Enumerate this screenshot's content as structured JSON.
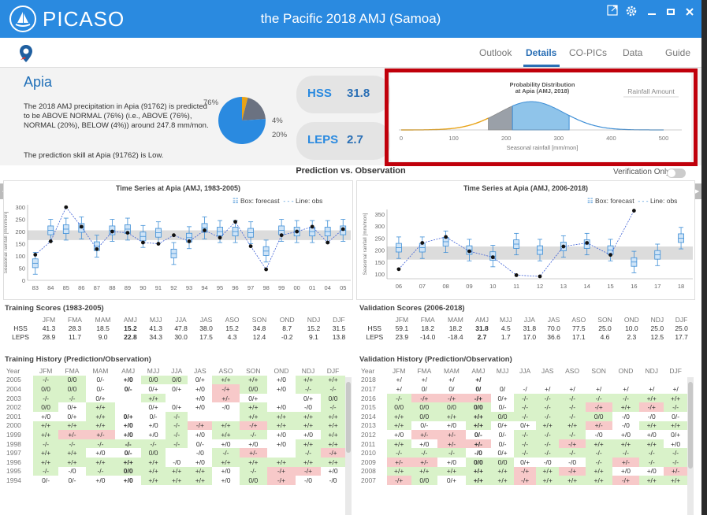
{
  "window": {
    "logo": "PICASO",
    "title": "the Pacific 2018 AMJ (Samoa)"
  },
  "nav": {
    "tabs": [
      "Outlook",
      "Details",
      "CO-PICs",
      "Data",
      "Guide"
    ],
    "active": "Details"
  },
  "summary": {
    "city": "Apia",
    "description": "The 2018 AMJ precipitation in Apia (91762) is predicted to be ABOVE NORMAL (76%) (i.e., ABOVE (76%), NORMAL (20%), BELOW (4%)) around 247.8 mm/mon.",
    "skill_text": "The prediction skill at Apia (91762) is Low.",
    "pie": {
      "above": 76,
      "normal": 20,
      "below": 4,
      "above_label": "76%",
      "normal_label": "20%",
      "below_label": "4%",
      "colors": {
        "above": "#2a8ae0",
        "normal": "#6b7281",
        "below": "#e8a317"
      }
    },
    "hss_label": "HSS",
    "hss_value": "31.8",
    "leps_label": "LEPS",
    "leps_value": "2.7"
  },
  "distribution": {
    "title_line1": "Probability Distribution",
    "title_line2": "at Apia (AMJ, 2018)",
    "button": "Rainfall Amount",
    "xlabel": "Seasonal rainfall [mm/mon]",
    "ticks": [
      "0",
      "100",
      "200",
      "300",
      "400",
      "500"
    ]
  },
  "pvo": {
    "title": "Prediction vs. Observation",
    "verification_label": "Verification Only"
  },
  "colors": {
    "accent": "#2a8ae0",
    "highlight_red": "#c0000b",
    "good": "#d9f2c9",
    "bad": "#f7c9c9",
    "neutral": "#e2e2e2"
  },
  "chart_data": [
    {
      "type": "box",
      "title": "Time Series at Apia (AMJ, 1983-2005)",
      "ylabel": "Seasonal rainfall [mm/mon]",
      "legend_box": "Box: forecast",
      "legend_line": "Line: obs",
      "categories": [
        "83",
        "84",
        "85",
        "86",
        "87",
        "88",
        "89",
        "90",
        "91",
        "92",
        "93",
        "94",
        "95",
        "96",
        "97",
        "98",
        "99",
        "00",
        "01",
        "04",
        "05"
      ],
      "ylim": [
        0,
        310
      ],
      "yticks": [
        "0",
        "50",
        "100",
        "150",
        "200",
        "250",
        "300"
      ],
      "normal_band": [
        165,
        205
      ],
      "box_median": [
        70,
        205,
        210,
        215,
        140,
        205,
        210,
        180,
        195,
        110,
        175,
        215,
        200,
        200,
        195,
        120,
        205,
        200,
        200,
        200,
        205
      ],
      "observed": [
        105,
        160,
        300,
        220,
        128,
        200,
        195,
        155,
        150,
        185,
        160,
        205,
        175,
        240,
        140,
        45,
        185,
        200,
        220,
        155,
        210
      ]
    },
    {
      "type": "box",
      "title": "Time Series at Apia (AMJ, 2006-2018)",
      "ylabel": "Seasonal rainfall [mm/mon]",
      "legend_box": "Box: forecast",
      "legend_line": "Line: obs",
      "categories": [
        "06",
        "07",
        "08",
        "09",
        "10",
        "11",
        "12",
        "13",
        "14",
        "15",
        "16",
        "17",
        "18"
      ],
      "ylim": [
        80,
        370
      ],
      "yticks": [
        "100",
        "150",
        "200",
        "250",
        "300",
        "350"
      ],
      "normal_band": [
        160,
        215
      ],
      "box_median": [
        210,
        210,
        235,
        200,
        175,
        225,
        200,
        215,
        225,
        200,
        150,
        180,
        250
      ],
      "observed": [
        120,
        230,
        255,
        195,
        170,
        95,
        90,
        215,
        230,
        180,
        365
      ]
    }
  ],
  "training_scores": {
    "title": "Training Scores (1983-2005)",
    "months": [
      "JFM",
      "FMA",
      "MAM",
      "AMJ",
      "MJJ",
      "JJA",
      "JAS",
      "ASO",
      "SON",
      "OND",
      "NDJ",
      "DJF"
    ],
    "rows": [
      {
        "label": "HSS",
        "values": [
          "41.3",
          "28.3",
          "18.5",
          "15.2",
          "41.3",
          "47.8",
          "38.0",
          "15.2",
          "34.8",
          "8.7",
          "15.2",
          "31.5"
        ]
      },
      {
        "label": "LEPS",
        "values": [
          "28.9",
          "11.7",
          "9.0",
          "22.8",
          "34.3",
          "30.0",
          "17.5",
          "4.3",
          "12.4",
          "-0.2",
          "9.1",
          "13.8"
        ]
      }
    ]
  },
  "validation_scores": {
    "title": "Validation Scores (2006-2018)",
    "months": [
      "JFM",
      "FMA",
      "MAM",
      "AMJ",
      "MJJ",
      "JJA",
      "JAS",
      "ASO",
      "SON",
      "OND",
      "NDJ",
      "DJF"
    ],
    "rows": [
      {
        "label": "HSS",
        "values": [
          "59.1",
          "18.2",
          "18.2",
          "31.8",
          "4.5",
          "31.8",
          "70.0",
          "77.5",
          "25.0",
          "10.0",
          "25.0",
          "25.0"
        ]
      },
      {
        "label": "LEPS",
        "values": [
          "23.9",
          "-14.0",
          "-18.4",
          "2.7",
          "1.7",
          "17.0",
          "36.6",
          "17.1",
          "4.6",
          "2.3",
          "12.5",
          "17.7"
        ]
      }
    ]
  },
  "training_history": {
    "title": "Training History (Prediction/Observation)",
    "year_label": "Year",
    "months": [
      "JFM",
      "FMA",
      "MAM",
      "AMJ",
      "MJJ",
      "JJA",
      "JAS",
      "ASO",
      "SON",
      "OND",
      "NDJ",
      "DJF"
    ],
    "rows": [
      {
        "year": "2005",
        "cells": [
          "-/-",
          "0/0",
          "0/-",
          "+/0",
          "0/0",
          "0/0",
          "0/+",
          "+/+",
          "+/+",
          "+/0",
          "+/+",
          "+/+"
        ]
      },
      {
        "year": "2004",
        "cells": [
          "0/0",
          "0/0",
          "0/-",
          "0/-",
          "0/+",
          "0/+",
          "+/0",
          "-/+",
          "0/0",
          "+/0",
          "-/-",
          "-/-"
        ]
      },
      {
        "year": "2003",
        "cells": [
          "-/-",
          "-/-",
          "0/+",
          "",
          "+/+",
          "",
          "+/0",
          "+/-",
          "0/+",
          "",
          "0/+",
          "0/0"
        ]
      },
      {
        "year": "2002",
        "cells": [
          "0/0",
          "0/+",
          "+/+",
          "",
          "0/+",
          "0/+",
          "+/0",
          "-/0",
          "+/+",
          "+/0",
          "-/0",
          "-/-"
        ]
      },
      {
        "year": "2001",
        "cells": [
          "+/0",
          "0/+",
          "+/+",
          "0/+",
          "0/-",
          "-/-",
          "",
          "",
          "+/+",
          "+/+",
          "+/+",
          "+/+"
        ]
      },
      {
        "year": "2000",
        "cells": [
          "+/+",
          "+/+",
          "+/+",
          "+/0",
          "+/0",
          "-/-",
          "-/+",
          "+/+",
          "-/+",
          "+/+",
          "+/+",
          "+/+"
        ]
      },
      {
        "year": "1999",
        "cells": [
          "+/+",
          "+/-",
          "+/-",
          "+/0",
          "+/0",
          "-/-",
          "+/0",
          "+/+",
          "-/-",
          "+/0",
          "+/0",
          "+/+"
        ]
      },
      {
        "year": "1998",
        "cells": [
          "-/-",
          "-/-",
          "-/-",
          "-/-",
          "-/-",
          "-/-",
          "0/-",
          "+/0",
          "+/0",
          "+/0",
          "+/+",
          "+/+"
        ]
      },
      {
        "year": "1997",
        "cells": [
          "+/+",
          "+/+",
          "+/0",
          "0/-",
          "0/0",
          "",
          "-/0",
          "-/-",
          "+/-",
          "",
          "-/-",
          "-/+"
        ]
      },
      {
        "year": "1996",
        "cells": [
          "+/+",
          "+/+",
          "+/+",
          "+/+",
          "+/+",
          "-/0",
          "+/0",
          "+/+",
          "+/+",
          "+/+",
          "+/+",
          "+/+"
        ]
      },
      {
        "year": "1995",
        "cells": [
          "-/-",
          "-/0",
          "-/-",
          "0/0",
          "+/+",
          "+/+",
          "+/+",
          "+/0",
          "-/-",
          "-/+",
          "-/+",
          "+/0"
        ]
      },
      {
        "year": "1994",
        "cells": [
          "0/-",
          "0/-",
          "+/0",
          "+/0",
          "+/+",
          "+/+",
          "+/+",
          "+/0",
          "0/0",
          "-/+",
          "-/0",
          "-/0"
        ]
      }
    ]
  },
  "validation_history": {
    "title": "Validation History (Prediction/Observation)",
    "year_label": "Year",
    "months": [
      "JFM",
      "FMA",
      "MAM",
      "AMJ",
      "MJJ",
      "JJA",
      "JAS",
      "ASO",
      "SON",
      "OND",
      "NDJ",
      "DJF"
    ],
    "rows": [
      {
        "year": "2018",
        "cells": [
          "+/",
          "+/",
          "+/",
          "+/",
          "",
          "",
          "",
          "",
          "",
          "",
          "",
          ""
        ]
      },
      {
        "year": "2017",
        "cells": [
          "+/",
          "0/",
          "0/",
          "0/",
          "0/",
          "-/",
          "+/",
          "+/",
          "+/",
          "+/",
          "+/",
          "+/"
        ]
      },
      {
        "year": "2016",
        "cells": [
          "-/-",
          "-/+",
          "-/+",
          "-/+",
          "0/+",
          "-/-",
          "-/-",
          "-/-",
          "-/-",
          "-/-",
          "+/+",
          "+/+"
        ]
      },
      {
        "year": "2015",
        "cells": [
          "0/0",
          "0/0",
          "0/0",
          "0/0",
          "0/-",
          "-/-",
          "-/-",
          "-/-",
          "-/+",
          "+/+",
          "-/+",
          "-/-"
        ]
      },
      {
        "year": "2014",
        "cells": [
          "+/+",
          "0/0",
          "+/+",
          "+/+",
          "0/0",
          "-/-",
          "-/-",
          "-/-",
          "0/0",
          "-/0",
          "-/0",
          "0/-"
        ]
      },
      {
        "year": "2013",
        "cells": [
          "+/+",
          "0/-",
          "+/0",
          "+/+",
          "0/+",
          "0/+",
          "+/+",
          "+/+",
          "+/-",
          "-/0",
          "+/+",
          "+/+"
        ]
      },
      {
        "year": "2012",
        "cells": [
          "+/0",
          "+/-",
          "+/-",
          "0/-",
          "0/-",
          "-/-",
          "-/-",
          "-/-",
          "-/0",
          "+/0",
          "+/0",
          "0/+"
        ]
      },
      {
        "year": "2011",
        "cells": [
          "+/+",
          "+/0",
          "+/-",
          "+/-",
          "0/-",
          "-/-",
          "-/-",
          "-/+",
          "+/+",
          "+/+",
          "+/+",
          "+/0"
        ]
      },
      {
        "year": "2010",
        "cells": [
          "-/-",
          "-/-",
          "-/-",
          "-/0",
          "0/+",
          "-/-",
          "-/-",
          "-/-",
          "-/-",
          "-/-",
          "-/-",
          "-/-"
        ]
      },
      {
        "year": "2009",
        "cells": [
          "+/-",
          "+/-",
          "+/0",
          "0/0",
          "0/0",
          "0/+",
          "-/0",
          "-/0",
          "-/-",
          "+/-",
          "-/-",
          "-/-"
        ]
      },
      {
        "year": "2008",
        "cells": [
          "+/+",
          "+/+",
          "+/+",
          "+/+",
          "+/+",
          "-/+",
          "+/+",
          "-/+",
          "+/+",
          "+/0",
          "+/0",
          "+/-"
        ]
      },
      {
        "year": "2007",
        "cells": [
          "-/+",
          "0/0",
          "0/+",
          "+/+",
          "+/+",
          "-/+",
          "+/+",
          "+/+",
          "+/+",
          "-/+",
          "+/+",
          "+/+"
        ]
      }
    ]
  }
}
